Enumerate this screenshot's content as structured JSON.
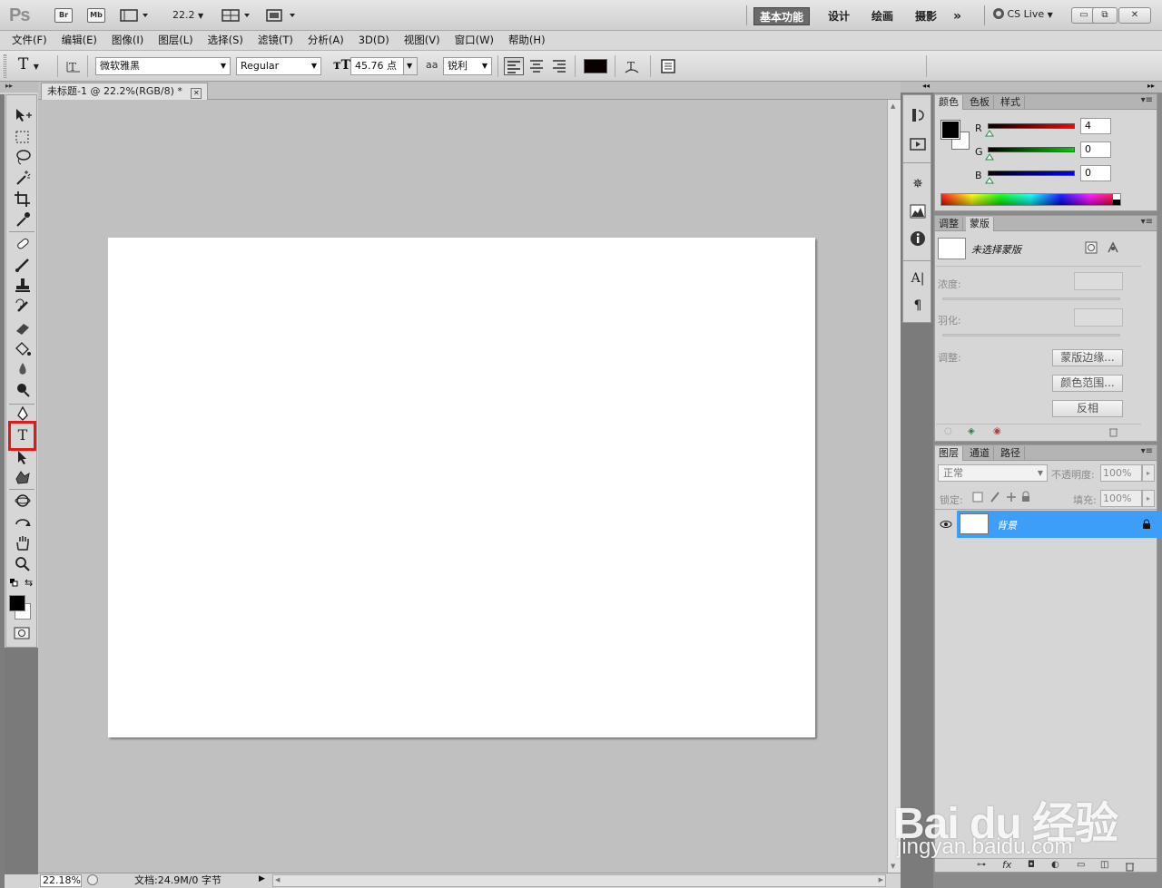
{
  "appbar": {
    "logo": "Ps",
    "bridge_label": "Br",
    "minibridge_label": "Mb",
    "zoom_value": "22.2",
    "workspaces": [
      "基本功能",
      "设计",
      "绘画",
      "摄影"
    ],
    "more_label": "»",
    "cslive_label": "CS Live",
    "window_buttons": [
      "▭",
      "⧉",
      "✕"
    ]
  },
  "menubar": {
    "items": [
      "文件(F)",
      "编辑(E)",
      "图像(I)",
      "图层(L)",
      "选择(S)",
      "滤镜(T)",
      "分析(A)",
      "3D(D)",
      "视图(V)",
      "窗口(W)",
      "帮助(H)"
    ]
  },
  "options": {
    "tool_glyph": "T",
    "font_family": "微软雅黑",
    "font_style": "Regular",
    "font_size": "45.76 点",
    "antialias_prefix": "aa",
    "antialias": "锐利",
    "text_color": "#0a0000"
  },
  "document": {
    "tab_title": "未标题-1 @ 22.2%(RGB/8) *",
    "tab_close": "✕",
    "canvas_color": "#ffffff"
  },
  "status": {
    "zoom": "22.18%",
    "doc_info": "文档:24.9M/0 字节"
  },
  "tools": {
    "icons": [
      "move-icon",
      "marquee-icon",
      "lasso-icon",
      "magic-wand-icon",
      "crop-icon",
      "eyedropper-icon",
      "healing-brush-icon",
      "brush-icon",
      "clone-stamp-icon",
      "history-brush-icon",
      "eraser-icon",
      "paint-bucket-icon",
      "blur-icon",
      "dodge-icon",
      "pen-icon",
      "type-icon",
      "path-select-icon",
      "custom-shape-icon",
      "3d-rotate-icon",
      "3d-orbit-icon",
      "hand-icon",
      "zoom-icon"
    ],
    "type_glyph": "T",
    "foreground": "#000000",
    "background": "#ffffff"
  },
  "color_panel": {
    "tabs": [
      "颜色",
      "色板",
      "样式"
    ],
    "r_label": "R",
    "r_value": "4",
    "g_label": "G",
    "g_value": "0",
    "b_label": "B",
    "b_value": "0"
  },
  "mask_panel": {
    "tabs": [
      "调整",
      "蒙版"
    ],
    "no_mask_label": "未选择蒙版",
    "density_label": "浓度:",
    "feather_label": "羽化:",
    "refine_label": "调整:",
    "mask_edge_button": "蒙版边缘...",
    "color_range_button": "颜色范围...",
    "invert_button": "反相"
  },
  "layers_panel": {
    "tabs": [
      "图层",
      "通道",
      "路径"
    ],
    "blend_mode": "正常",
    "opacity_label": "不透明度:",
    "opacity_value": "100%",
    "lock_label": "锁定:",
    "fill_label": "填充:",
    "fill_value": "100%",
    "layers": [
      {
        "name": "背景",
        "selected": true
      }
    ]
  },
  "watermark": {
    "brand": "Bai du 经验",
    "url": "jingyan.baidu.com"
  }
}
